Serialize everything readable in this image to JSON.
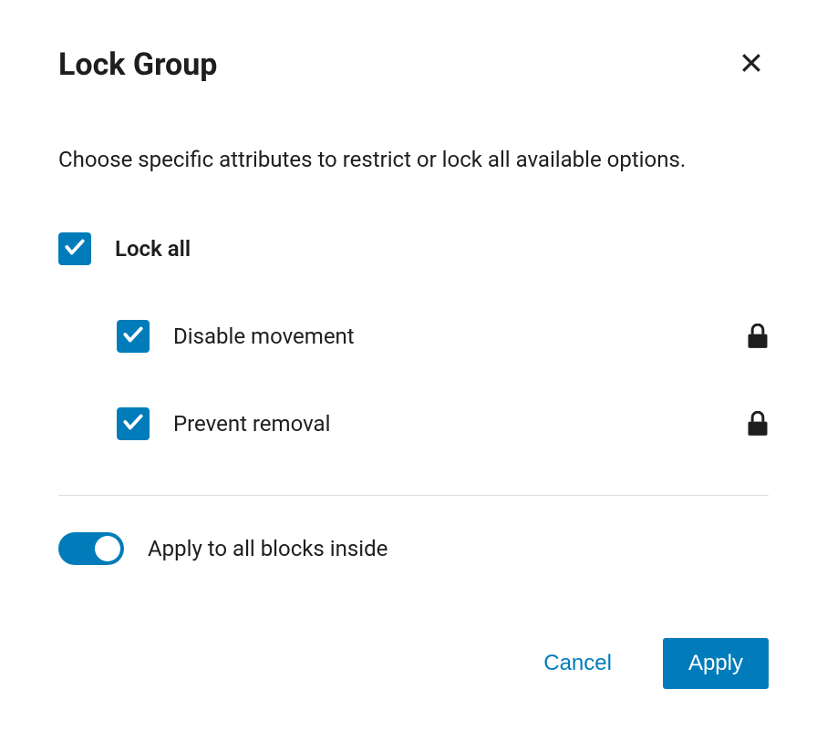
{
  "modal": {
    "title": "Lock Group",
    "description": "Choose specific attributes to restrict or lock all available options.",
    "options": {
      "lock_all": {
        "label": "Lock all",
        "checked": true
      },
      "disable_movement": {
        "label": "Disable movement",
        "checked": true,
        "locked": true
      },
      "prevent_removal": {
        "label": "Prevent removal",
        "checked": true,
        "locked": true
      }
    },
    "toggle": {
      "label": "Apply to all blocks inside",
      "enabled": true
    },
    "buttons": {
      "cancel": "Cancel",
      "apply": "Apply"
    }
  },
  "colors": {
    "primary": "#007cba",
    "text": "#1e1e1e"
  }
}
